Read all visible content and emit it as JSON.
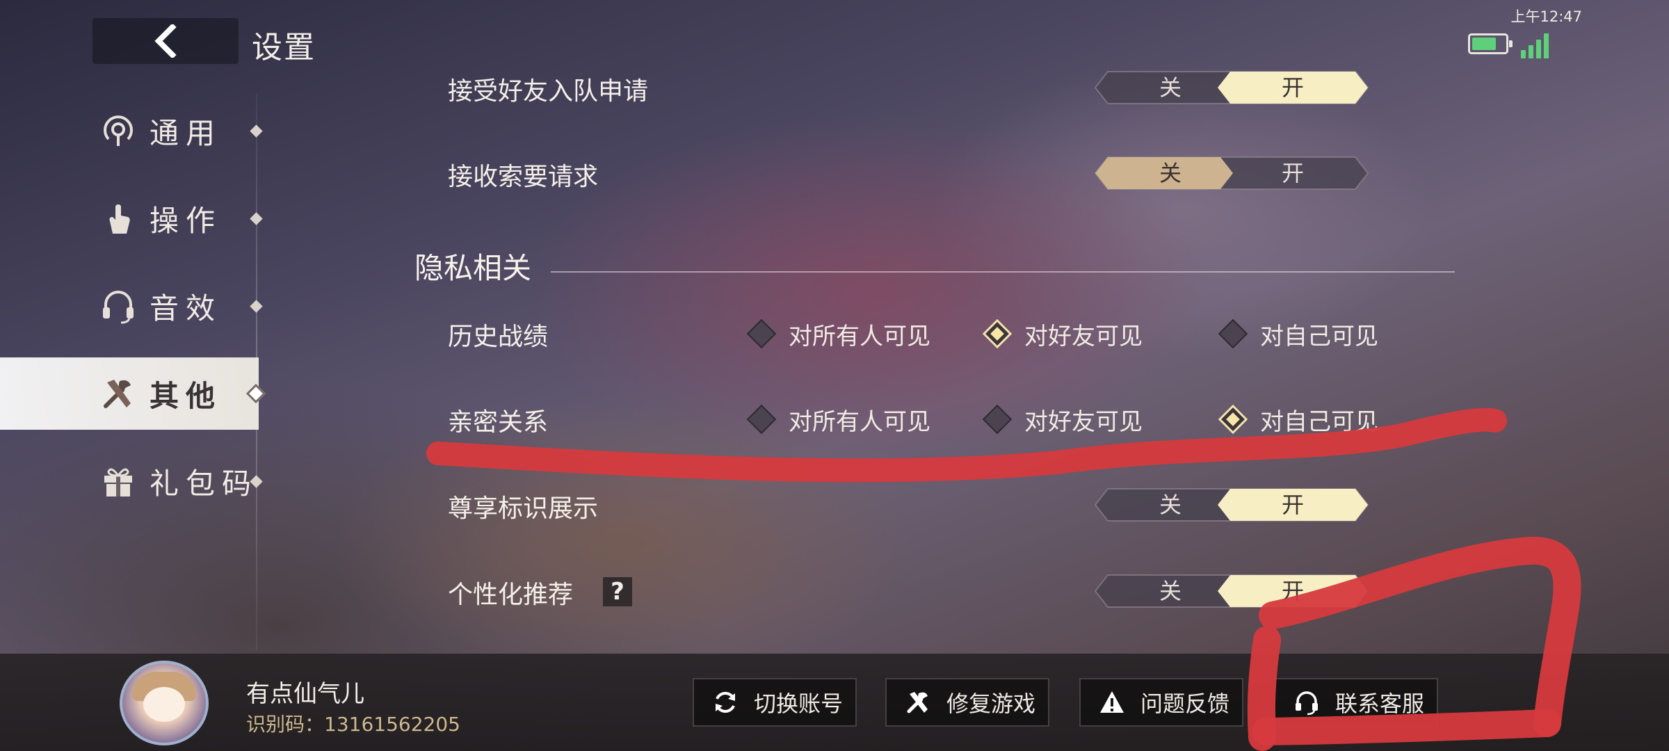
{
  "status": {
    "time": "上午12:47",
    "battery_color": "#5fd07a",
    "signal_color": "#5fd07a"
  },
  "header": {
    "title": "设置",
    "back_icon": "chevron-left-icon"
  },
  "sidebar": {
    "items": [
      {
        "label": "通用",
        "icon": "general-icon",
        "active": false
      },
      {
        "label": "操作",
        "icon": "hand-icon",
        "active": false
      },
      {
        "label": "音效",
        "icon": "headset-icon",
        "active": false
      },
      {
        "label": "其他",
        "icon": "tools-icon",
        "active": true
      },
      {
        "label": "礼包码",
        "icon": "gift-icon",
        "active": false
      }
    ]
  },
  "settings": {
    "accept_team_invites": {
      "label": "接受好友入队申请",
      "off": "关",
      "on": "开",
      "value": "开"
    },
    "accept_requests": {
      "label": "接收索要请求",
      "off": "关",
      "on": "开",
      "value": "关"
    },
    "privacy_section": {
      "title": "隐私相关"
    },
    "history_record": {
      "label": "历史战绩",
      "options": [
        "对所有人可见",
        "对好友可见",
        "对自己可见"
      ],
      "selected": "对好友可见"
    },
    "intimacy": {
      "label": "亲密关系",
      "options": [
        "对所有人可见",
        "对好友可见",
        "对自己可见"
      ],
      "selected": "对自己可见"
    },
    "premium_badge": {
      "label": "尊享标识展示",
      "off": "关",
      "on": "开",
      "value": "开"
    },
    "personalized": {
      "label": "个性化推荐",
      "help": "?",
      "off": "关",
      "on": "开",
      "value": "开"
    }
  },
  "user": {
    "name": "有点仙气儿",
    "id": "识别码：13161562205"
  },
  "actions": {
    "switch_account": {
      "label": "切换账号",
      "icon": "refresh-icon"
    },
    "repair_game": {
      "label": "修复游戏",
      "icon": "tools-icon"
    },
    "feedback": {
      "label": "问题反馈",
      "icon": "warning-icon"
    },
    "customer_service": {
      "label": "联系客服",
      "icon": "headset-icon"
    }
  },
  "colors": {
    "selected_gold": "#f7eec4",
    "selected_tan": "#cdb390",
    "annotation_red": "#d63a3e"
  }
}
